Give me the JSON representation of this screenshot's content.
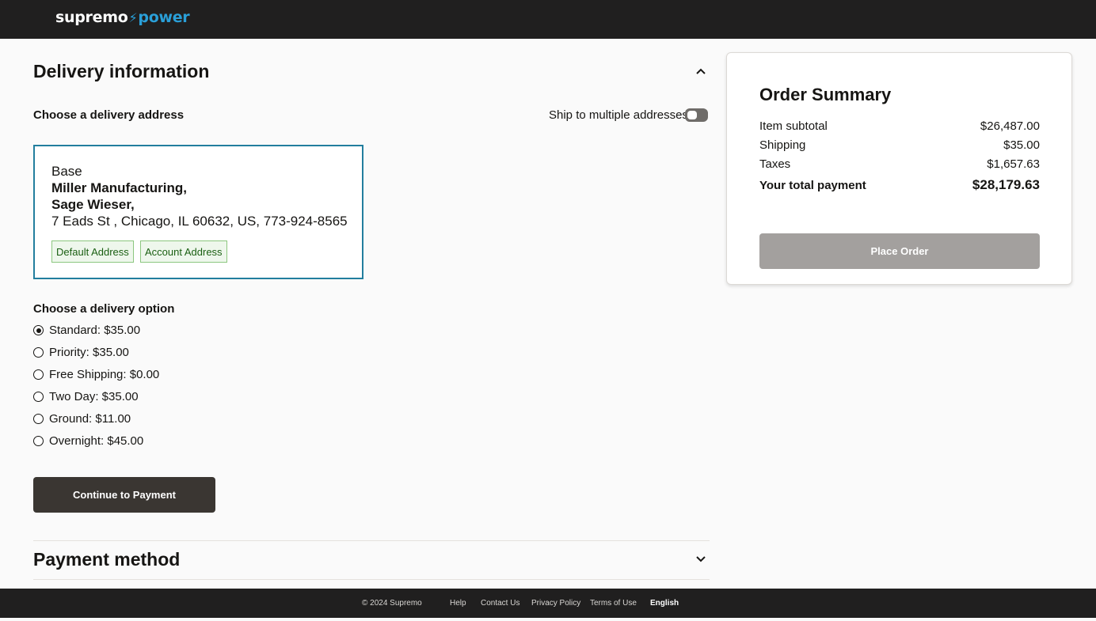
{
  "header": {
    "logo_left": "supremo",
    "logo_bolt": "⚡",
    "logo_right": "power"
  },
  "delivery": {
    "title": "Delivery information",
    "address_label": "Choose a delivery address",
    "ship_multiple_label": "Ship to multiple addresses",
    "ship_multiple_enabled": false,
    "address": {
      "name": "Base",
      "company": "Miller Manufacturing,",
      "contact": "Sage Wieser,",
      "line": "7 Eads St , Chicago, IL 60632, US, 773-924-8565",
      "tags": [
        "Default Address",
        "Account Address"
      ]
    },
    "option_label": "Choose a delivery option",
    "options": [
      {
        "label": "Standard: $35.00",
        "selected": true
      },
      {
        "label": "Priority: $35.00",
        "selected": false
      },
      {
        "label": "Free Shipping: $0.00",
        "selected": false
      },
      {
        "label": "Two Day: $35.00",
        "selected": false
      },
      {
        "label": "Ground: $11.00",
        "selected": false
      },
      {
        "label": "Overnight: $45.00",
        "selected": false
      }
    ],
    "continue_label": "Continue to Payment"
  },
  "payment": {
    "title": "Payment method"
  },
  "summary": {
    "title": "Order Summary",
    "rows": [
      {
        "label": "Item subtotal",
        "value": "$26,487.00"
      },
      {
        "label": "Shipping",
        "value": "$35.00"
      },
      {
        "label": "Taxes",
        "value": "$1,657.63"
      }
    ],
    "total_label": "Your total payment",
    "total_value": "$28,179.63",
    "place_order_label": "Place Order"
  },
  "footer": {
    "copyright": "© 2024 Supremo",
    "links": [
      "Help",
      "Contact Us",
      "Privacy Policy",
      "Terms of Use"
    ],
    "language": "English"
  },
  "colors": {
    "header_bg": "#201f1f",
    "accent": "#2a9fd8",
    "address_border": "#227e9e",
    "primary_button": "#3a3632",
    "disabled_button": "#a3a09e",
    "tag_border": "#8cc77f"
  },
  "icons": {
    "delivery_collapse": "chevron-up-icon",
    "payment_expand": "chevron-down-icon"
  }
}
